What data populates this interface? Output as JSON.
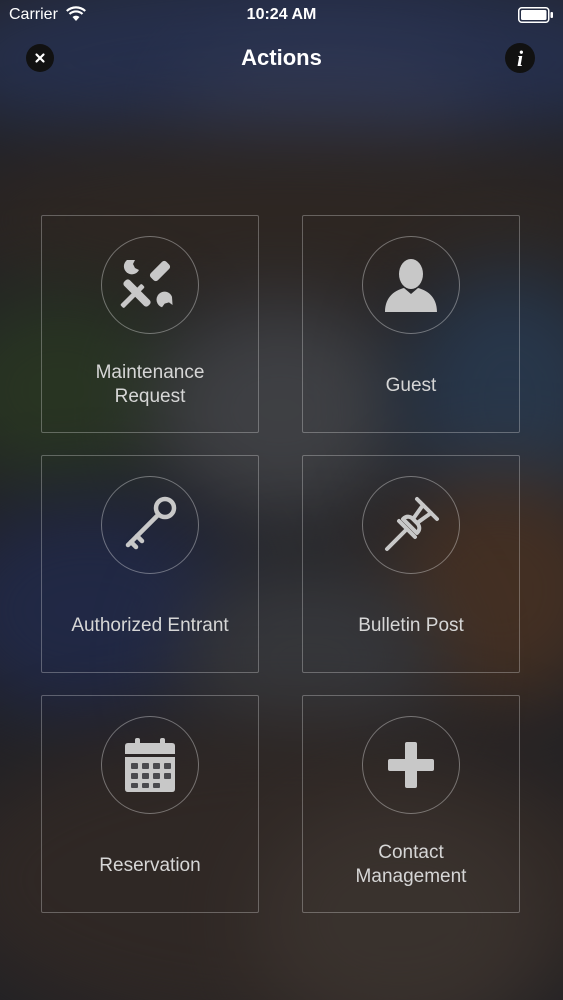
{
  "status_bar": {
    "carrier": "Carrier",
    "time": "10:24 AM"
  },
  "nav": {
    "title": "Actions",
    "left_icon": "close-icon",
    "right_icon": "info-icon"
  },
  "actions": [
    {
      "label_line1": "Maintenance",
      "label_line2": "Request",
      "icon": "tools-icon"
    },
    {
      "label_line1": "Guest",
      "label_line2": "",
      "icon": "person-icon"
    },
    {
      "label_line1": "Authorized Entrant",
      "label_line2": "",
      "icon": "key-icon"
    },
    {
      "label_line1": "Bulletin Post",
      "label_line2": "",
      "icon": "pushpin-icon"
    },
    {
      "label_line1": "Reservation",
      "label_line2": "",
      "icon": "calendar-icon"
    },
    {
      "label_line1": "Contact",
      "label_line2": "Management",
      "icon": "plus-icon"
    }
  ],
  "colors": {
    "icon_gray": "#c8c8c8",
    "label_gray": "#d6d6d6",
    "tile_border": "rgba(255,255,255,0.28)"
  }
}
